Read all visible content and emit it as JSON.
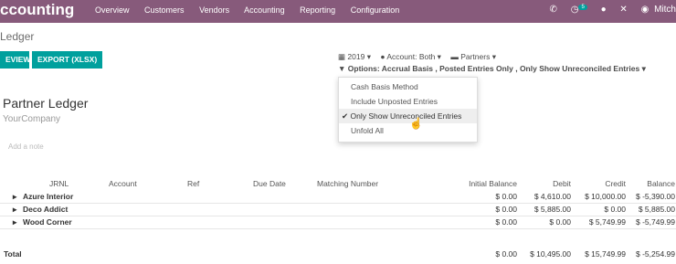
{
  "topbar": {
    "brand": "ccounting",
    "menu": [
      "Overview",
      "Customers",
      "Vendors",
      "Accounting",
      "Reporting",
      "Configuration"
    ],
    "chat_badge": "5",
    "user": "Mitch"
  },
  "breadcrumb": "Ledger",
  "buttons": {
    "preview": "EVIEW",
    "export": "EXPORT (XLSX)"
  },
  "filters": {
    "year": "2019",
    "account": "Account: Both",
    "partners": "Partners",
    "options": "Options: Accrual Basis , Posted Entries Only , Only Show Unreconciled Entries"
  },
  "dropdown": {
    "items": [
      "Cash Basis Method",
      "Include Unposted Entries",
      "Only Show Unreconciled Entries",
      "Unfold All"
    ],
    "checked": "Only Show Unreconciled Entries"
  },
  "report": {
    "title": "Partner Ledger",
    "company": "YourCompany",
    "note_placeholder": "Add a note",
    "columns": [
      "JRNL",
      "Account",
      "Ref",
      "Due Date",
      "Matching Number",
      "Initial Balance",
      "Debit",
      "Credit",
      "Balance"
    ],
    "rows": [
      {
        "name": "Azure Interior",
        "initial": "$ 0.00",
        "debit": "$ 4,610.00",
        "credit": "$ 10,000.00",
        "balance": "$ -5,390.00"
      },
      {
        "name": "Deco Addict",
        "initial": "$ 0.00",
        "debit": "$ 5,885.00",
        "credit": "$ 0.00",
        "balance": "$ 5,885.00"
      },
      {
        "name": "Wood Corner",
        "initial": "$ 0.00",
        "debit": "$ 0.00",
        "credit": "$ 5,749.99",
        "balance": "$ -5,749.99"
      }
    ],
    "total": {
      "label": "Total",
      "initial": "$ 0.00",
      "debit": "$ 10,495.00",
      "credit": "$ 15,749.99",
      "balance": "$ -5,254.99"
    }
  }
}
